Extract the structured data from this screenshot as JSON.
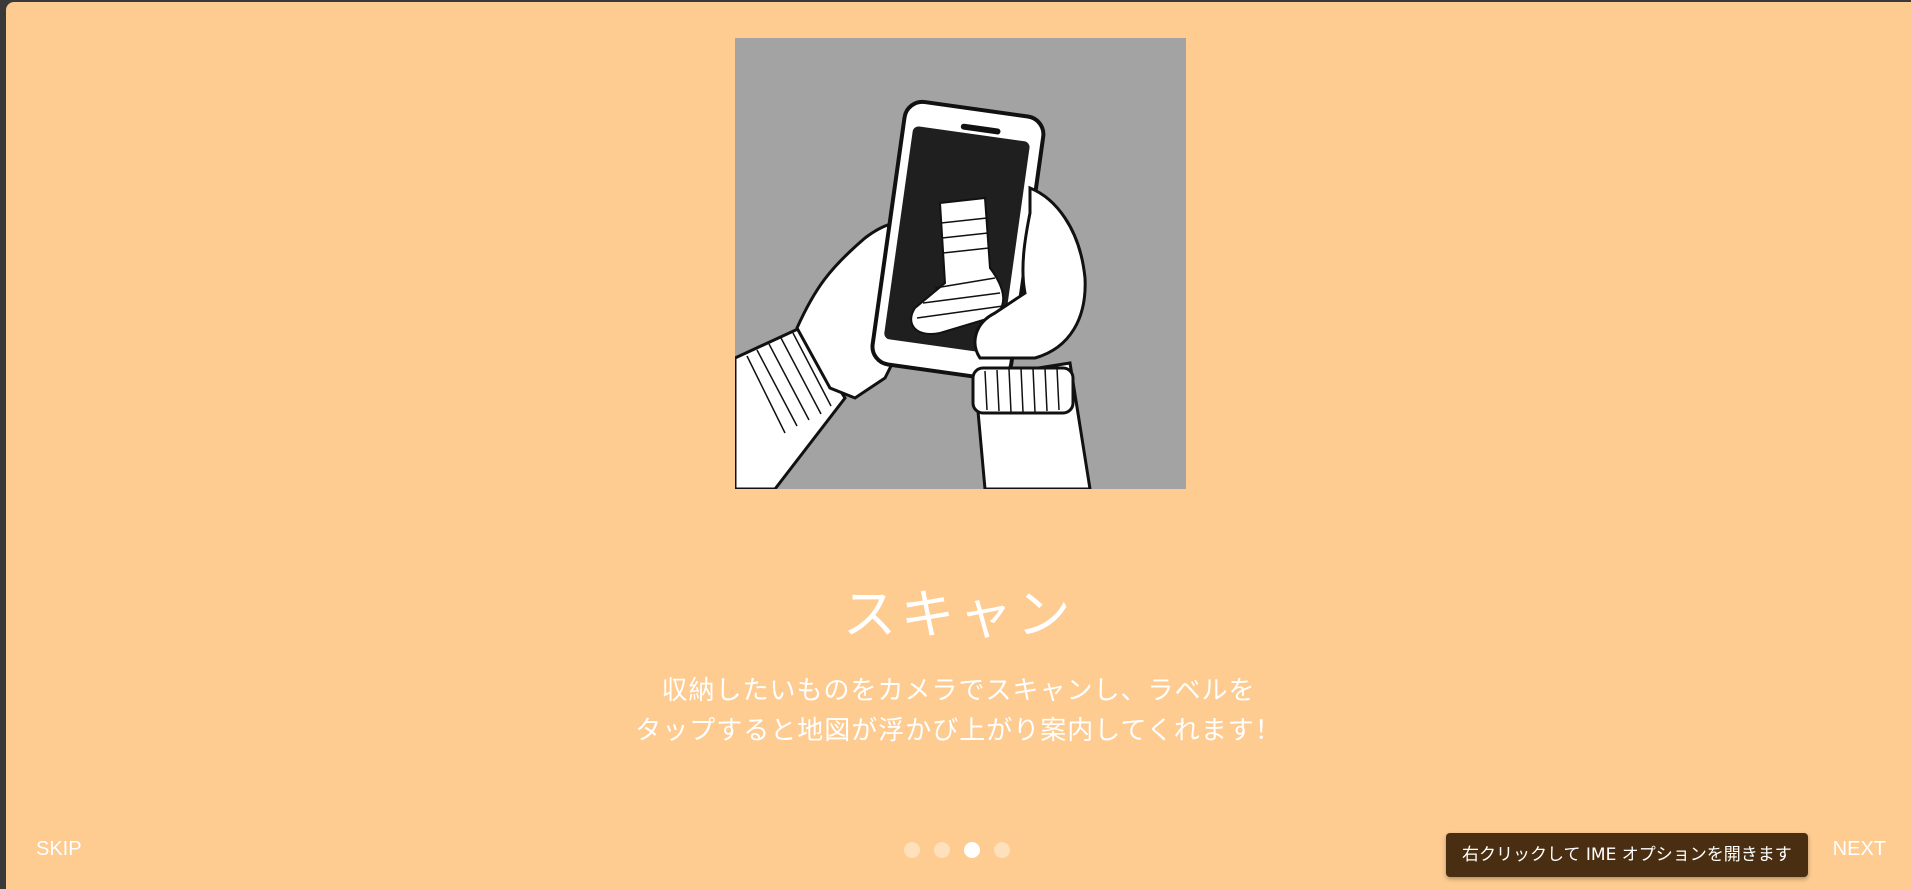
{
  "onboarding": {
    "illustration_name": "hands-holding-phone-scanning-sock",
    "title": "スキャン",
    "description_lines": [
      "収納したいものをカメラでスキャンし、ラベルを",
      "タップすると地図が浮かび上がり案内してくれます！"
    ],
    "skip_label": "SKIP",
    "next_label": "NEXT",
    "page_count": 4,
    "current_page": 3
  },
  "tooltip": {
    "text": "右クリックして IME オプションを開きます"
  },
  "colors": {
    "background": "#fecb91",
    "illustration_bg": "#a3a3a3",
    "text": "#ffffff",
    "tooltip_bg": "#4a2e12"
  }
}
